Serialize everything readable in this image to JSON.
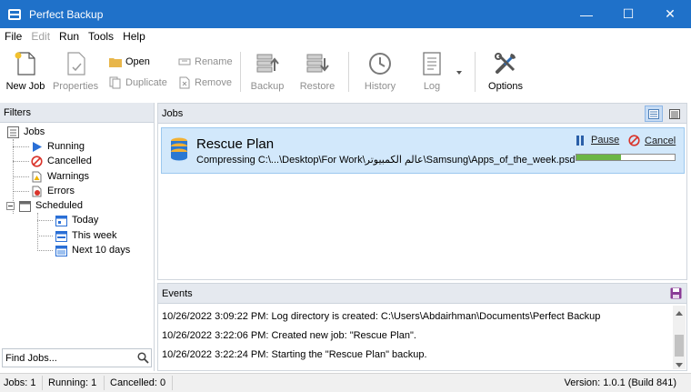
{
  "window": {
    "title": "Perfect Backup",
    "minimize_glyph": "—",
    "maximize_glyph": "☐",
    "close_glyph": "✕"
  },
  "menu": [
    {
      "label": "File",
      "enabled": true
    },
    {
      "label": "Edit",
      "enabled": false
    },
    {
      "label": "Run",
      "enabled": true
    },
    {
      "label": "Tools",
      "enabled": true
    },
    {
      "label": "Help",
      "enabled": true
    }
  ],
  "toolbar": {
    "new_job": "New Job",
    "properties": "Properties",
    "open": "Open",
    "duplicate": "Duplicate",
    "rename": "Rename",
    "remove": "Remove",
    "backup": "Backup",
    "restore": "Restore",
    "history": "History",
    "log": "Log",
    "options": "Options"
  },
  "filters": {
    "header": "Filters",
    "tree": {
      "jobs": "Jobs",
      "running": "Running",
      "cancelled": "Cancelled",
      "warnings": "Warnings",
      "errors": "Errors",
      "scheduled": "Scheduled",
      "today": "Today",
      "this_week": "This week",
      "next_10_days": "Next 10 days"
    },
    "find_placeholder": "Find Jobs..."
  },
  "jobs_panel": {
    "header": "Jobs",
    "job": {
      "name": "Rescue Plan",
      "status": "Compressing C:\\...\\Desktop\\For Work\\عالم الكمبيوتر\\Samsung\\Apps_of_the_week.psd",
      "pause": "Pause",
      "cancel": "Cancel",
      "progress": 0.45
    }
  },
  "events_panel": {
    "header": "Events",
    "rows": [
      "10/26/2022 3:09:22 PM: Log directory is created: C:\\Users\\Abdairhman\\Documents\\Perfect Backup",
      "10/26/2022 3:22:06 PM: Created new job: \"Rescue Plan\".",
      "10/26/2022 3:22:24 PM: Starting the \"Rescue Plan\" backup."
    ]
  },
  "status_bar": {
    "jobs": "Jobs: 1",
    "running": "Running: 1",
    "cancelled": "Cancelled: 0",
    "version": "Version: 1.0.1 (Build 841)"
  },
  "colors": {
    "titlebar": "#1f71c9",
    "job_card_bg": "#d2e8fb",
    "progress_fill": "#6bb646",
    "running_icon": "#2a6fd6",
    "cancel_icon": "#d9342b"
  }
}
